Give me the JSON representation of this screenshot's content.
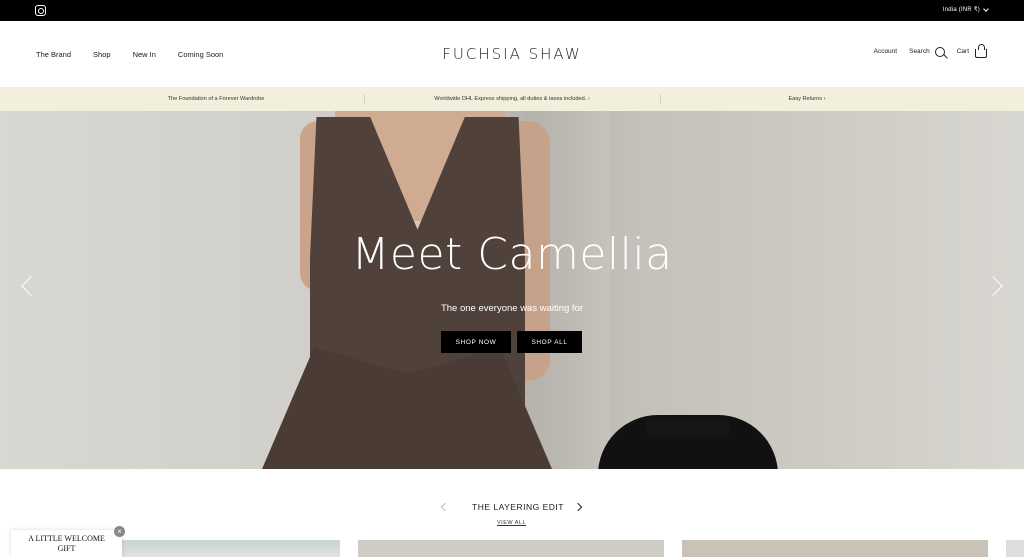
{
  "topbar": {
    "region": "India (INR ₹)"
  },
  "header": {
    "nav": [
      "The Brand",
      "Shop",
      "New In",
      "Coming Soon"
    ],
    "logo": "FUCHSIA SHAW",
    "account": "Account",
    "search": "Search",
    "cart": "Cart"
  },
  "promo": {
    "items": [
      "The Foundation of a Forever Wardrobe",
      "Worldwide DHL Express shipping, all duties & taxes included. ›",
      "Easy Returns ›"
    ]
  },
  "hero": {
    "title": "Meet Camellia",
    "subtitle": "The one everyone was waiting for",
    "btn_shop_now": "SHOP NOW",
    "btn_shop_all": "SHOP ALL"
  },
  "collection": {
    "title": "THE LAYERING EDIT",
    "view_all": "VIEW ALL"
  },
  "gift": {
    "line1": "A LITTLE WELCOME",
    "line2": "GIFT"
  },
  "colors": {
    "topbar": "#000000",
    "promo_bg": "#f2f0dc",
    "button": "#000000"
  }
}
